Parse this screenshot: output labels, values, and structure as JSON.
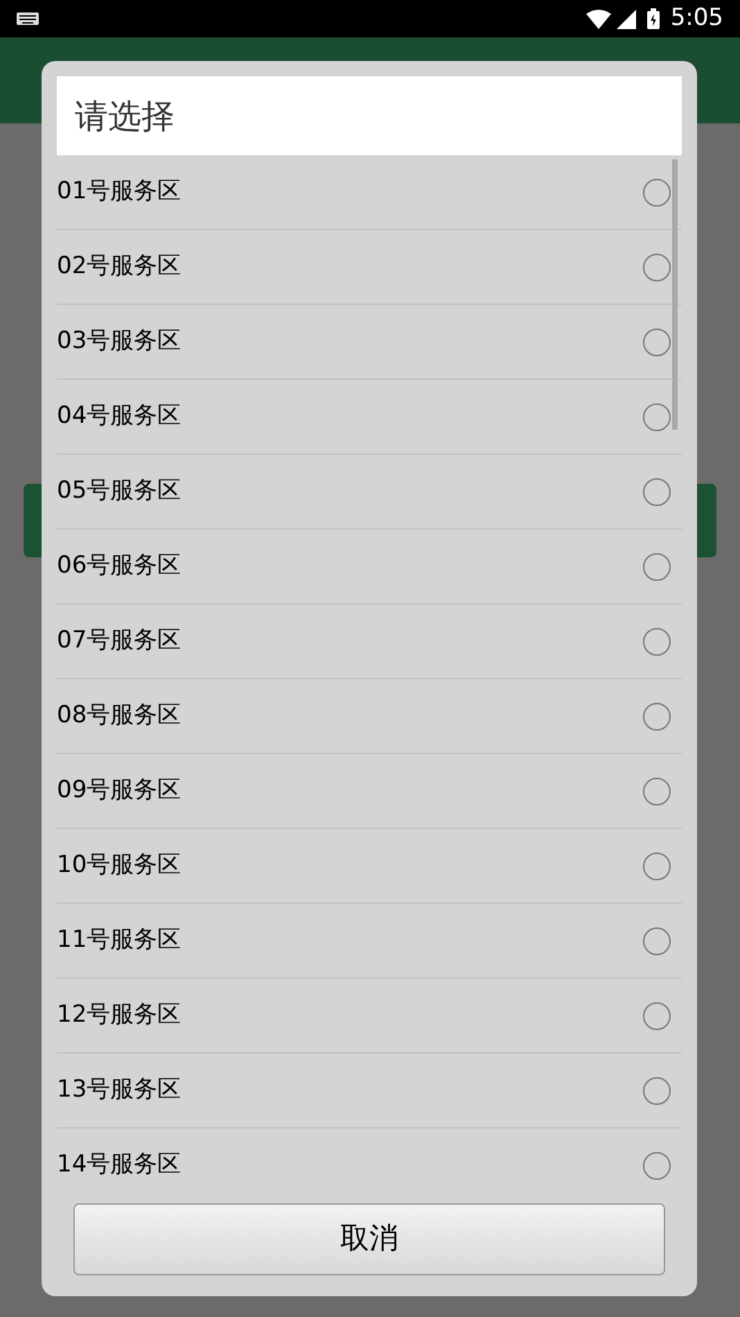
{
  "status_bar": {
    "time": "5:05"
  },
  "dialog": {
    "title": "请选择",
    "options": [
      {
        "label": "01号服务区",
        "selected": false
      },
      {
        "label": "02号服务区",
        "selected": false
      },
      {
        "label": "03号服务区",
        "selected": false
      },
      {
        "label": "04号服务区",
        "selected": false
      },
      {
        "label": "05号服务区",
        "selected": false
      },
      {
        "label": "06号服务区",
        "selected": false
      },
      {
        "label": "07号服务区",
        "selected": false
      },
      {
        "label": "08号服务区",
        "selected": false
      },
      {
        "label": "09号服务区",
        "selected": false
      },
      {
        "label": "10号服务区",
        "selected": false
      },
      {
        "label": "11号服务区",
        "selected": false
      },
      {
        "label": "12号服务区",
        "selected": false
      },
      {
        "label": "13号服务区",
        "selected": false
      },
      {
        "label": "14号服务区",
        "selected": false
      }
    ],
    "cancel_button": "取消"
  }
}
